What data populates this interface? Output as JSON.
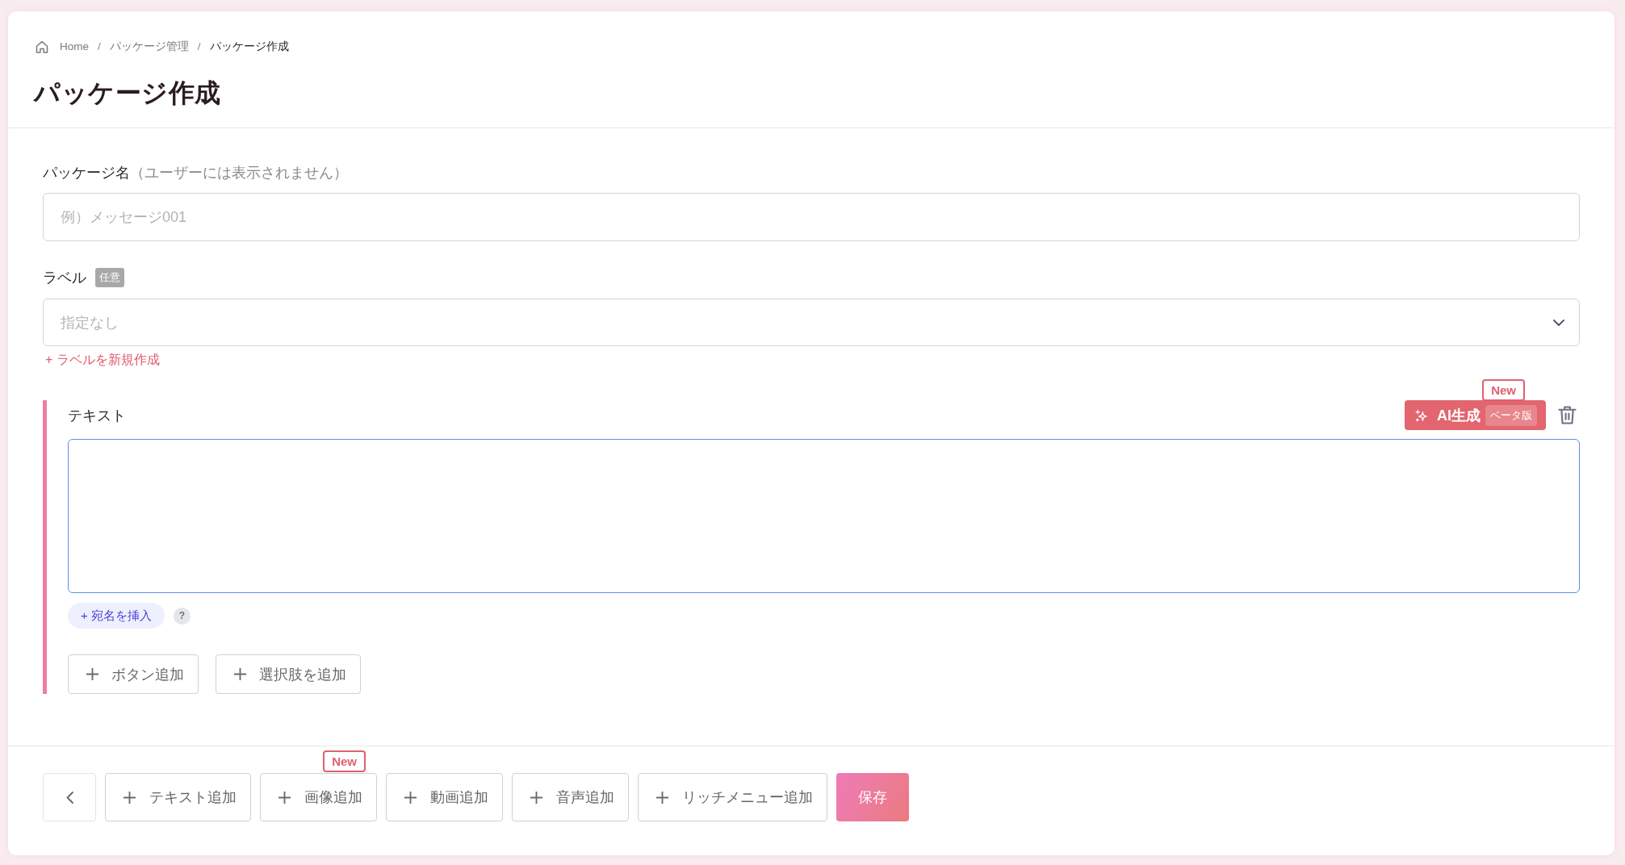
{
  "breadcrumb": [
    {
      "kind": "home",
      "label": "Home",
      "current": false
    },
    {
      "kind": "page",
      "separator": "/",
      "label": "パッケージ管理",
      "current": false
    },
    {
      "kind": "page",
      "separator": "/",
      "label": "パッケージ作成",
      "current": true
    }
  ],
  "title": "パッケージ作成",
  "fields": [
    {
      "kind": "text",
      "label": "パッケージ名",
      "note": "（ユーザーには表示されません）",
      "placeholder": "例）メッセージ001"
    },
    {
      "kind": "select",
      "label": "ラベル",
      "badge": "任意",
      "placeholder": "指定なし",
      "link": "+ ラベルを新規作成"
    }
  ],
  "message": {
    "label": "テキスト",
    "ai_button": {
      "label": "AI生成",
      "badge": "ベータ版",
      "new_badge": "New"
    },
    "textarea": {
      "focused": true
    },
    "insert_button": "+ 宛名を挿入",
    "help": "?",
    "buttons": [
      "ボタン追加",
      "選択肢を追加"
    ]
  },
  "footer": {
    "buttons": [
      {
        "label": "テキスト追加"
      },
      {
        "label": "画像追加",
        "new_badge": "New"
      },
      {
        "label": "動画追加"
      },
      {
        "label": "音声追加"
      },
      {
        "label": "リッチメニュー追加"
      }
    ],
    "save": "保存"
  }
}
